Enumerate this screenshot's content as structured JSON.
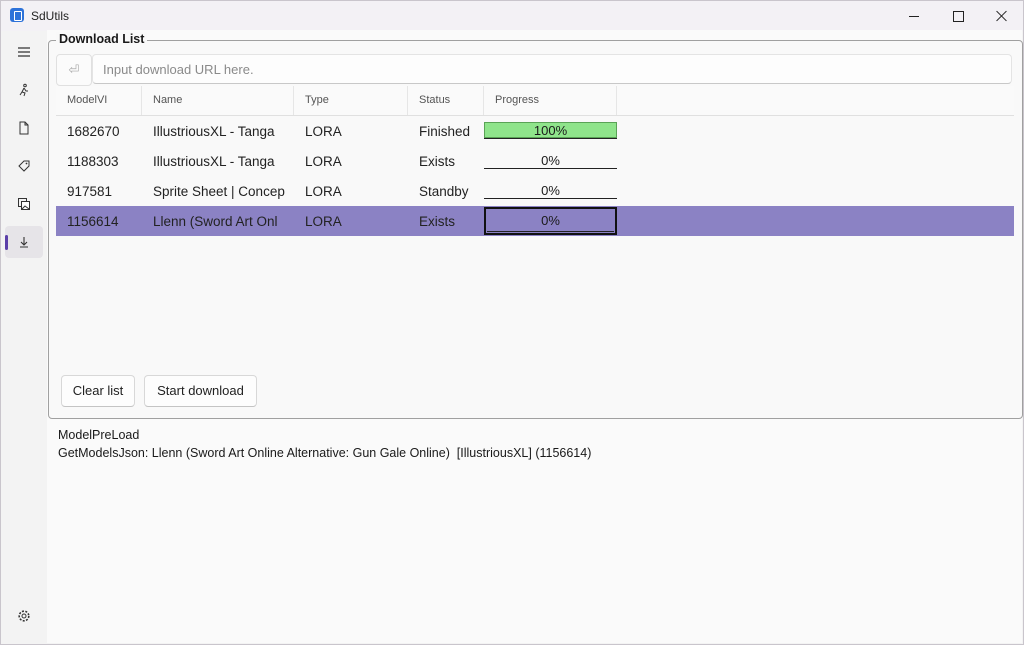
{
  "window": {
    "title": "SdUtils"
  },
  "nav": [
    {
      "icon": "hamburger-menu-icon"
    },
    {
      "icon": "runner-icon"
    },
    {
      "icon": "document-icon"
    },
    {
      "icon": "tag-icon"
    },
    {
      "icon": "image-gallery-icon"
    },
    {
      "icon": "download-icon",
      "active": true
    },
    {
      "icon": "gear-icon"
    }
  ],
  "download_list": {
    "title": "Download List",
    "url_placeholder": "Input download URL here.",
    "url_value": "",
    "enter_symbol": "⏎",
    "columns": [
      "ModelVI",
      "Name",
      "Type",
      "Status",
      "Progress"
    ],
    "rows": [
      {
        "id": "1682670",
        "name": "IllustriousXL - Tanga",
        "type": "LORA",
        "status": "Finished",
        "progress_label": "100%",
        "progress": 1.0,
        "selected": false
      },
      {
        "id": "1188303",
        "name": "IllustriousXL - Tanga",
        "type": "LORA",
        "status": "Exists",
        "progress_label": "0%",
        "progress": 0,
        "selected": false
      },
      {
        "id": "917581",
        "name": "Sprite Sheet | Concep",
        "type": "LORA",
        "status": "Standby",
        "progress_label": "0%",
        "progress": 0,
        "selected": false
      },
      {
        "id": "1156614",
        "name": "Llenn (Sword Art Onl",
        "type": "LORA",
        "status": "Exists",
        "progress_label": "0%",
        "progress": 0,
        "selected": true
      }
    ],
    "clear_label": "Clear list",
    "start_label": "Start download"
  },
  "log": {
    "lines": [
      "ModelPreLoad",
      "GetModelsJson: Llenn (Sword Art Online Alternative: Gun Gale Online)  [IllustriousXL] (1156614)"
    ]
  },
  "colors": {
    "accent": "#5b3fa8",
    "selection": "#8b82c4",
    "progress_fill": "#8fe48b"
  }
}
